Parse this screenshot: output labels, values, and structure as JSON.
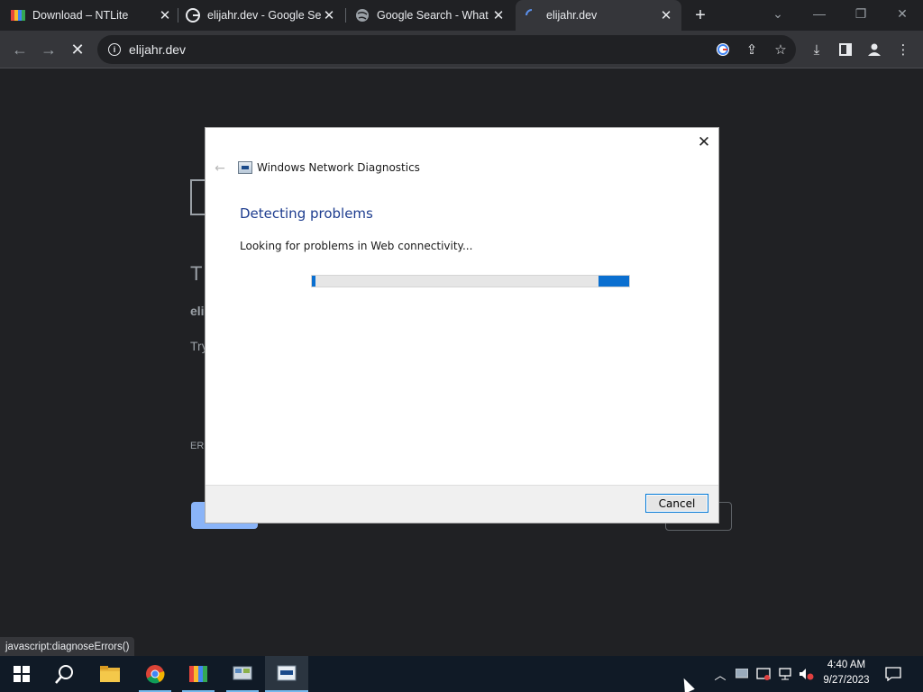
{
  "browser": {
    "tabs": [
      {
        "title": "Download – NTLite",
        "favicon": "ntlite-icon"
      },
      {
        "title": "elijahr.dev - Google Se",
        "favicon": "google-icon"
      },
      {
        "title": "Google Search - What",
        "favicon": "globe-icon"
      },
      {
        "title": "elijahr.dev",
        "favicon": "loading-spinner-icon",
        "active": true
      }
    ],
    "url": "elijahr.dev",
    "status_bar": "javascript:diagnoseErrors()"
  },
  "page": {
    "title_partial": "T",
    "host_partial": "eli",
    "try_partial": "Try",
    "code_partial": "ER"
  },
  "dialog": {
    "app_title": "Windows Network Diagnostics",
    "heading": "Detecting problems",
    "message": "Looking for problems in Web connectivity...",
    "cancel_label": "Cancel",
    "progress": "indeterminate"
  },
  "taskbar": {
    "time": "4:40 AM",
    "date": "9/27/2023"
  },
  "colors": {
    "accent": "#0078d7",
    "heading": "#1e3d8f",
    "chrome_bg": "#202124"
  }
}
